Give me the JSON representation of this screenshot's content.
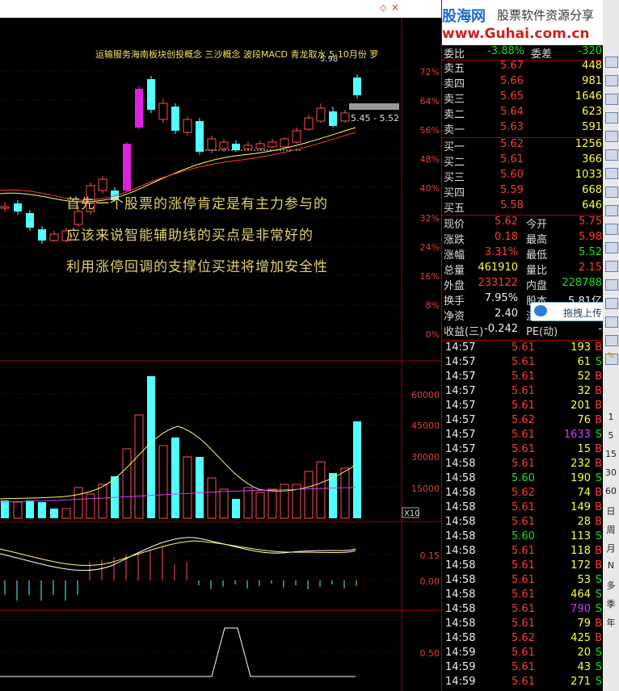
{
  "chart": {
    "title": "运输服务海南板块创投概念 三沙概念 波段MACD 青龙取水 5-10月份 罗",
    "price_high": "5.98",
    "price_range_label": "5.45 - 5.52",
    "pct_ticks": [
      "72%",
      "64%",
      "56%",
      "48%",
      "40%",
      "32%",
      "24%",
      "16%",
      "8%",
      "0%"
    ],
    "vol_ticks": [
      "60000",
      "45000",
      "30000",
      "15000"
    ],
    "vol_unit": "X10",
    "macd_ticks": [
      "0.15",
      "0.00"
    ],
    "ind_ticks": [
      "0.50"
    ],
    "annotation": [
      "首先一个股票的涨停肯定是有主力参与的",
      "应该来说智能辅助线的买点是非常好的",
      "利用涨停回调的支撑位买进将增加安全性"
    ],
    "colors": {
      "up": "#ff5050",
      "down": "#50ffff",
      "limit": "#e020e0",
      "ma1": "#ffff60",
      "ma2": "#ff4040",
      "ma3": "#ffffff"
    }
  },
  "brand": {
    "logo": "股海网",
    "tagline": "股票软件资源分享",
    "url": "www.Guhai.com.cn"
  },
  "quote": {
    "weibi": {
      "label": "委比",
      "value": "-3.88%",
      "label2": "委差",
      "value2": "-320"
    },
    "asks": [
      {
        "label": "卖五",
        "price": "5.67",
        "vol": "448"
      },
      {
        "label": "卖四",
        "price": "5.66",
        "vol": "981"
      },
      {
        "label": "卖三",
        "price": "5.65",
        "vol": "1646"
      },
      {
        "label": "卖二",
        "price": "5.64",
        "vol": "623"
      },
      {
        "label": "卖一",
        "price": "5.63",
        "vol": "591"
      }
    ],
    "bids": [
      {
        "label": "买一",
        "price": "5.62",
        "vol": "1256"
      },
      {
        "label": "买二",
        "price": "5.61",
        "vol": "366"
      },
      {
        "label": "买三",
        "price": "5.60",
        "vol": "1033"
      },
      {
        "label": "买四",
        "price": "5.59",
        "vol": "668"
      },
      {
        "label": "买五",
        "price": "5.58",
        "vol": "646"
      }
    ],
    "stats": [
      {
        "l1": "现价",
        "v1": "5.62",
        "l2": "今开",
        "v2": "5.75"
      },
      {
        "l1": "涨跌",
        "v1": "0.18",
        "l2": "最高",
        "v2": "5.98"
      },
      {
        "l1": "涨幅",
        "v1": "3.31%",
        "l2": "最低",
        "v2": "5.52"
      },
      {
        "l1": "总量",
        "v1": "461910",
        "l2": "量比",
        "v2": "2.15"
      },
      {
        "l1": "外盘",
        "v1": "233122",
        "l2": "内盘",
        "v2": "228788"
      },
      {
        "l1": "换手",
        "v1": "7.95%",
        "l2": "股本",
        "v2": "5.81亿"
      },
      {
        "l1": "净资",
        "v1": "2.40",
        "l2": "流通",
        "v2": ""
      },
      {
        "l1": "收益(三)",
        "v1": "-0.242",
        "l2": "PE(动)",
        "v2": "-"
      }
    ],
    "ticks": [
      {
        "t": "14:57",
        "p": "5.61",
        "v": "193",
        "s": "B"
      },
      {
        "t": "14:57",
        "p": "5.61",
        "v": "61",
        "s": "S"
      },
      {
        "t": "14:57",
        "p": "5.61",
        "v": "52",
        "s": "B"
      },
      {
        "t": "14:57",
        "p": "5.61",
        "v": "32",
        "s": "B"
      },
      {
        "t": "14:57",
        "p": "5.61",
        "v": "201",
        "s": "B"
      },
      {
        "t": "14:57",
        "p": "5.62",
        "v": "76",
        "s": "B"
      },
      {
        "t": "14:57",
        "p": "5.61",
        "v": "1633",
        "s": "S"
      },
      {
        "t": "14:57",
        "p": "5.61",
        "v": "15",
        "s": "B"
      },
      {
        "t": "14:58",
        "p": "5.61",
        "v": "232",
        "s": "B"
      },
      {
        "t": "14:58",
        "p": "5.60",
        "v": "190",
        "s": "S"
      },
      {
        "t": "14:58",
        "p": "5.62",
        "v": "74",
        "s": "B"
      },
      {
        "t": "14:58",
        "p": "5.61",
        "v": "149",
        "s": "B"
      },
      {
        "t": "14:58",
        "p": "5.61",
        "v": "28",
        "s": "B"
      },
      {
        "t": "14:58",
        "p": "5.60",
        "v": "113",
        "s": "S"
      },
      {
        "t": "14:58",
        "p": "5.61",
        "v": "118",
        "s": "B"
      },
      {
        "t": "14:58",
        "p": "5.61",
        "v": "172",
        "s": "B"
      },
      {
        "t": "14:58",
        "p": "5.61",
        "v": "53",
        "s": "S"
      },
      {
        "t": "14:58",
        "p": "5.61",
        "v": "464",
        "s": "S"
      },
      {
        "t": "14:58",
        "p": "5.61",
        "v": "790",
        "s": "S"
      },
      {
        "t": "14:58",
        "p": "5.61",
        "v": "79",
        "s": "B"
      },
      {
        "t": "14:58",
        "p": "5.62",
        "v": "425",
        "s": "B"
      },
      {
        "t": "14:59",
        "p": "5.61",
        "v": "20",
        "s": "S"
      },
      {
        "t": "14:59",
        "p": "5.61",
        "v": "43",
        "s": "S"
      },
      {
        "t": "14:59",
        "p": "5.61",
        "v": "271",
        "s": "S"
      }
    ],
    "upload_label": "拖拽上传"
  },
  "toolbar": {
    "labels": [
      "1",
      "5",
      "15",
      "30",
      "60",
      "日",
      "周",
      "月",
      "N",
      "多",
      "季",
      "年"
    ]
  }
}
